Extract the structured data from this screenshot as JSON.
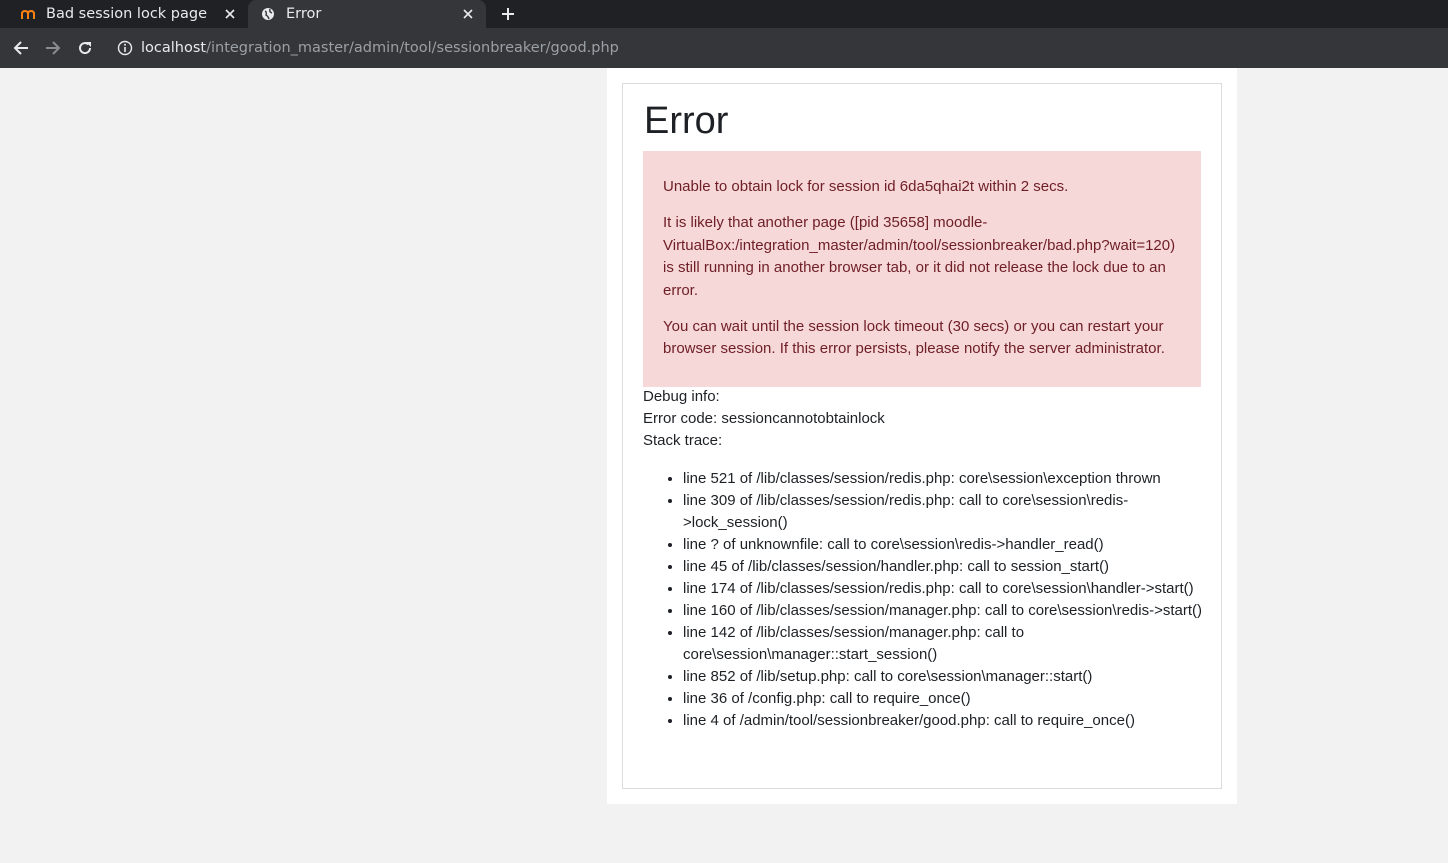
{
  "browser": {
    "tabs": [
      {
        "title": "Bad session lock page",
        "favicon": "moodle-icon",
        "active": false
      },
      {
        "title": "Error",
        "favicon": "globe-icon",
        "active": true
      }
    ],
    "url_host": "localhost",
    "url_path": "/integration_master/admin/tool/sessionbreaker/good.php"
  },
  "page": {
    "title": "Error",
    "alert": {
      "line1": "Unable to obtain lock for session id 6da5qhai2t within 2 secs.",
      "line2": "It is likely that another page ([pid 35658] moodle-VirtualBox:/integration_master/admin/tool/sessionbreaker/bad.php?wait=120) is still running in another browser tab, or it did not release the lock due to an error.",
      "line3": "You can wait until the session lock timeout (30 secs) or you can restart your browser session. If this error persists, please notify the server administrator."
    },
    "debug": {
      "info_label": "Debug info:",
      "error_code": "Error code: sessioncannotobtainlock",
      "stack_label": "Stack trace:"
    },
    "stack": [
      "line 521 of /lib/classes/session/redis.php: core\\session\\exception thrown",
      "line 309 of /lib/classes/session/redis.php: call to core\\session\\redis->lock_session()",
      "line ? of unknownfile: call to core\\session\\redis->handler_read()",
      "line 45 of /lib/classes/session/handler.php: call to session_start()",
      "line 174 of /lib/classes/session/redis.php: call to core\\session\\handler->start()",
      "line 160 of /lib/classes/session/manager.php: call to core\\session\\redis->start()",
      "line 142 of /lib/classes/session/manager.php: call to core\\session\\manager::start_session()",
      "line 852 of /lib/setup.php: call to core\\session\\manager::start()",
      "line 36 of /config.php: call to require_once()",
      "line 4 of /admin/tool/sessionbreaker/good.php: call to require_once()"
    ]
  }
}
